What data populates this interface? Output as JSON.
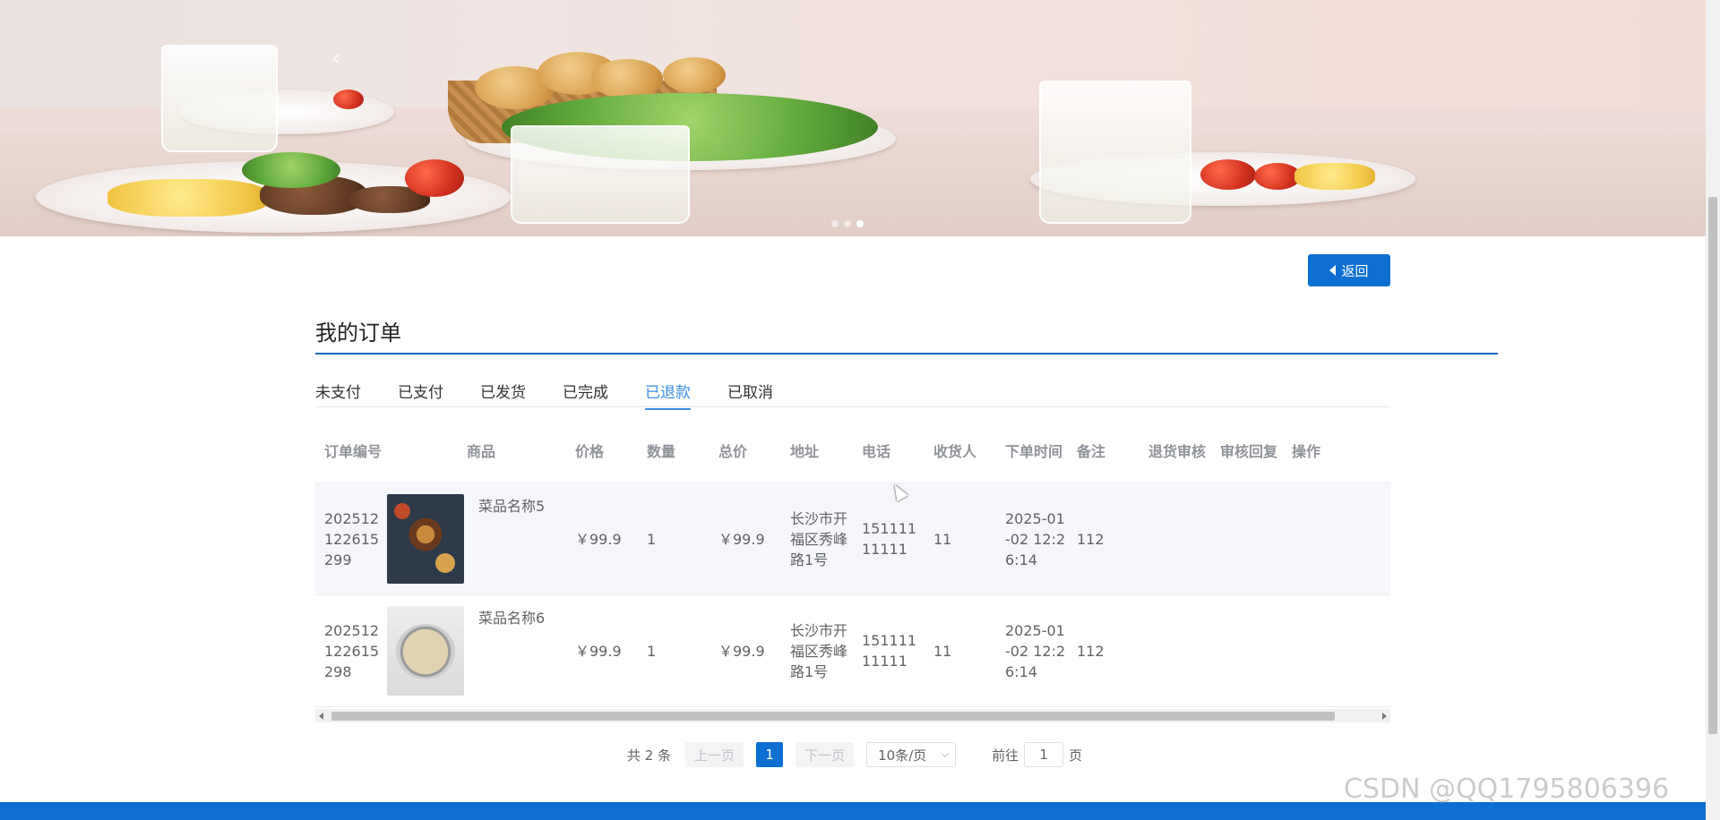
{
  "banner": {
    "prev_arrow": "‹",
    "dots": [
      false,
      false,
      true
    ]
  },
  "back_button": {
    "label": "返回",
    "icon": "caret-left-icon"
  },
  "page_title": "我的订单",
  "tabs": [
    {
      "label": "未支付",
      "active": false
    },
    {
      "label": "已支付",
      "active": false
    },
    {
      "label": "已发货",
      "active": false
    },
    {
      "label": "已完成",
      "active": false
    },
    {
      "label": "已退款",
      "active": true
    },
    {
      "label": "已取消",
      "active": false
    }
  ],
  "table": {
    "headers": [
      "订单编号",
      "商品",
      "价格",
      "数量",
      "总价",
      "地址",
      "电话",
      "收货人",
      "下单时间",
      "备注",
      "退货审核",
      "审核回复",
      "操作"
    ],
    "rows": [
      {
        "order_no": "202512122615299",
        "goods_name": "菜品名称5",
        "price": "￥99.9",
        "qty": "1",
        "total": "￥99.9",
        "address": "长沙市开福区秀峰路1号",
        "phone": "15111111111",
        "receiver": "11",
        "order_time": "2025-01-02 12:26:14",
        "remark": "112",
        "return_review": "",
        "review_reply": "",
        "action": ""
      },
      {
        "order_no": "202512122615298",
        "goods_name": "菜品名称6",
        "price": "￥99.9",
        "qty": "1",
        "total": "￥99.9",
        "address": "长沙市开福区秀峰路1号",
        "phone": "15111111111",
        "receiver": "11",
        "order_time": "2025-01-02 12:26:14",
        "remark": "112",
        "return_review": "",
        "review_reply": "",
        "action": ""
      }
    ]
  },
  "pagination": {
    "total": "共 2 条",
    "prev": "上一页",
    "current": "1",
    "next": "下一页",
    "page_size": "10条/页",
    "goto_prefix": "前往",
    "goto_value": "1",
    "goto_suffix": "页"
  },
  "watermark": "CSDN @QQ1795806396",
  "colors": {
    "primary": "#0d6fd1",
    "active_tab": "#3a8ee6",
    "rule": "#1266c4"
  }
}
